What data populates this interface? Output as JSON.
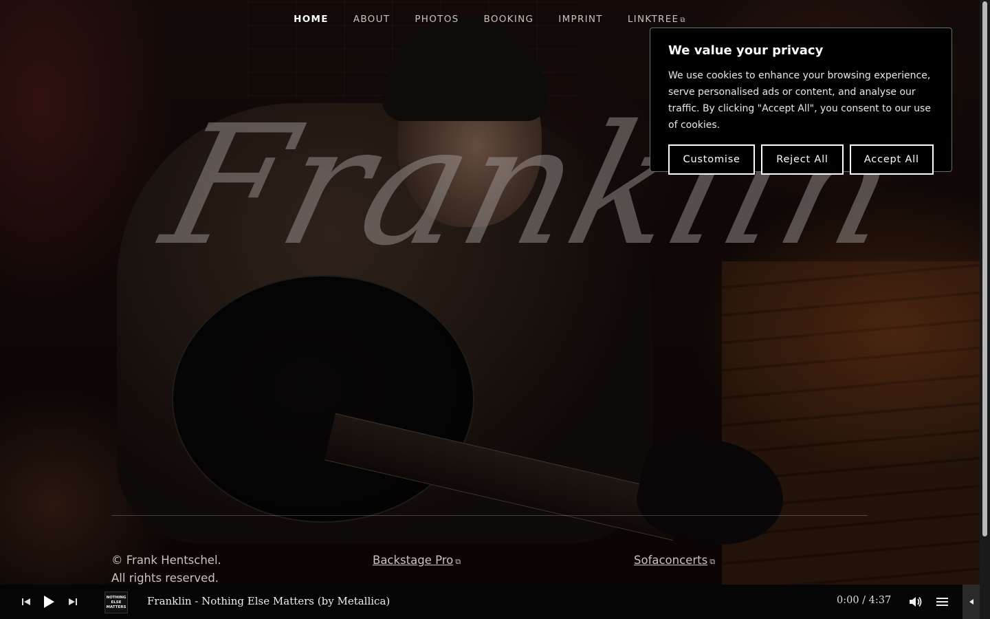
{
  "nav": {
    "items": [
      {
        "label": "HOME"
      },
      {
        "label": "ABOUT"
      },
      {
        "label": "PHOTOS"
      },
      {
        "label": "BOOKING"
      },
      {
        "label": "IMPRINT"
      },
      {
        "label": "LINKTREE"
      }
    ]
  },
  "hero": {
    "title": "Franklin"
  },
  "cookie": {
    "title": "We value your privacy",
    "text": "We use cookies to enhance your browsing experience, serve personalised ads or content, and analyse our traffic. By clicking \"Accept All\", you consent to our use of cookies.",
    "customise": "Customise",
    "reject": "Reject All",
    "accept": "Accept All"
  },
  "footer": {
    "copyright_line1": "© Frank Hentschel.",
    "copyright_line2": "All rights reserved.",
    "link1": "Backstage Pro",
    "link2": "Sofaconcerts"
  },
  "player": {
    "track": "Franklin - Nothing Else Matters (by Metallica)",
    "time": "0:00 / 4:37",
    "artwork_text": [
      "NOTHING",
      "ELSE",
      "MATTERS"
    ]
  },
  "icons": {
    "prev": "skip-previous-icon",
    "play": "play-icon",
    "next": "skip-next-icon",
    "volume": "volume-icon",
    "playlist": "playlist-icon",
    "toggle": "collapse-arrow-icon",
    "external": "external-link-icon"
  }
}
